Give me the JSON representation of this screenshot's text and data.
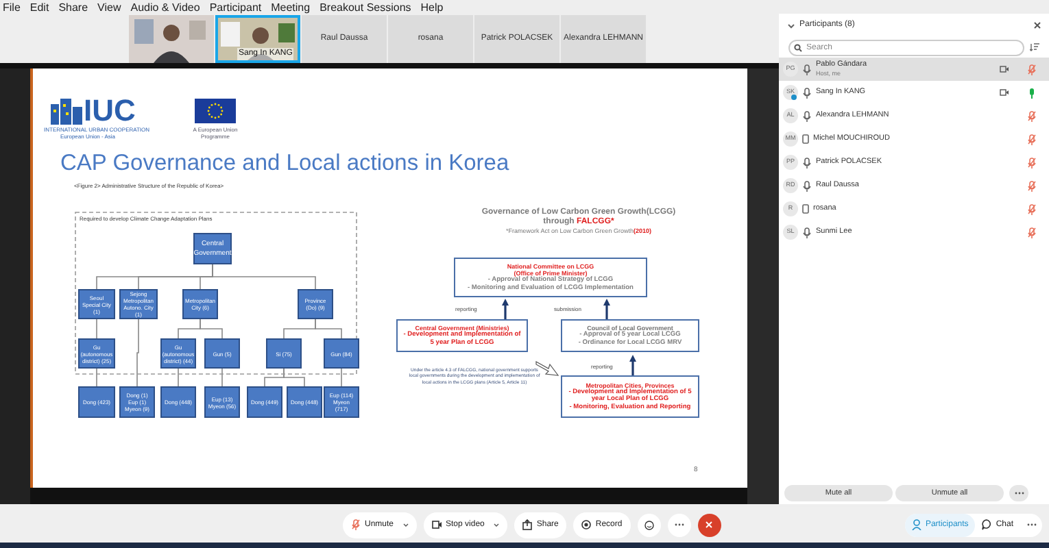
{
  "menu_bar": [
    "File",
    "Edit",
    "Share",
    "View",
    "Audio & Video",
    "Participant",
    "Meeting",
    "Breakout Sessions",
    "Help"
  ],
  "video_strip": [
    {
      "kind": "video",
      "speaking": false
    },
    {
      "kind": "video",
      "name": "Sang In KANG",
      "speaking": true
    },
    {
      "kind": "tile",
      "name": "Raul Daussa",
      "speaking": false
    },
    {
      "kind": "tile",
      "name": "rosana",
      "speaking": false
    },
    {
      "kind": "tile",
      "name": "Patrick POLACSEK",
      "speaking": false
    },
    {
      "kind": "tile",
      "name": "Alexandra LEHMANN",
      "speaking": false
    }
  ],
  "slide": {
    "logo_sub": "INTERNATIONAL URBAN COOPERATION",
    "logo_sub2": "European Union - Asia",
    "logo": "IUC",
    "eu_caption": "A European Union Programme",
    "title": "CAP Governance and Local actions in Korea",
    "caption": "<Figure 2> Administrative Structure of the Republic of Korea>",
    "frame_label": "Required to develop Climate Change Adaptation Plans",
    "org_chart": {
      "label": "Central Government",
      "children": [
        {
          "label": "Seoul Special City (1)",
          "children": [
            {
              "label": "Gu (autonomous district) (25)",
              "children": [
                {
                  "label": "Dong (423)"
                }
              ]
            }
          ]
        },
        {
          "label": "Sejong Metropolitan Autono. City (1)",
          "children": [
            {
              "label": "Dong (1) Eup (1) Myeon (9)"
            }
          ]
        },
        {
          "label": "Metropolitan City (6)",
          "children": [
            {
              "label": "Gu (autonomous district) (44)",
              "children": [
                {
                  "label": "Dong (448)"
                }
              ]
            },
            {
              "label": "Gun (5)",
              "children": [
                {
                  "label": "Eup (13) Myeon (56)"
                }
              ]
            }
          ]
        },
        {
          "label": "Province (Do) (9)",
          "children": [
            {
              "label": "Si (75)",
              "children": [
                {
                  "label": "Dong (449)"
                },
                {
                  "label": "Dong (448)"
                }
              ]
            },
            {
              "label": "Gun (84)",
              "children": [
                {
                  "label": "Eup (114) Myeon (717)"
                }
              ]
            }
          ]
        }
      ]
    },
    "diagram_title": "Governance of Low Carbon Green Growth(LCGG)",
    "diagram_subtitle": "through",
    "diagram_subtitle_highlight": "FALCGG*",
    "diagram_note": "*Framework Act on Low Carbon Green Growth",
    "diagram_note_highlight": "(2010)",
    "boxes": [
      {
        "heading": {
          "lines": [
            "National Committee on LCGG",
            "(Office of Prime Minister)"
          ],
          "color": "#e02020"
        },
        "items": {
          "lines": [
            "- Approval of National Strategy of LCGG",
            "- Monitoring and Evaluation of LCGG Implementation"
          ],
          "color": "#808080"
        }
      },
      {
        "heading": {
          "lines": [
            "Central Government (Ministries)"
          ],
          "color": "#e02020"
        },
        "items": {
          "lines": [
            "- Development and Implementation of 5 year Plan of LCGG"
          ],
          "color": "#e02020"
        }
      },
      {
        "heading": {
          "lines": [
            "Council of Local Government"
          ],
          "color": "#707070"
        },
        "items": {
          "lines": [
            "- Approval of 5 year Local LCGG",
            "- Ordinance for Local LCGG MRV"
          ],
          "color": "#808080"
        }
      },
      {
        "heading": {
          "lines": [
            "Metropolitan Cities, Provinces"
          ],
          "color": "#e02020"
        },
        "items": {
          "lines": [
            "- Development and Implementation of 5 year Local Plan of LCGG",
            "- Monitoring, Evaluation and Reporting"
          ],
          "color": "#e02020"
        }
      }
    ],
    "arrow_labels": [
      "reporting",
      "submission",
      "reporting"
    ],
    "paragraph": "Under the article 4.3 of FALCGG, national government supports local governments during the development and implementation of local actions in the LCGG plans (Article 5, Article 11)",
    "page_number": "8"
  },
  "participants_panel": {
    "title": "Participants (8)",
    "search_placeholder": "Search",
    "participants": [
      {
        "initials": "PG",
        "name": "Pablo Gándara",
        "subtitle": "Host, me",
        "kind": "mic",
        "video": true,
        "muted": true,
        "selected": true,
        "sharing": false
      },
      {
        "initials": "SK",
        "name": "Sang In KANG",
        "kind": "mic",
        "video": true,
        "muted": false,
        "selected": false,
        "sharing": true
      },
      {
        "initials": "AL",
        "name": "Alexandra LEHMANN",
        "kind": "mic",
        "video": false,
        "muted": true,
        "selected": false,
        "sharing": false
      },
      {
        "initials": "MM",
        "name": "Michel MOUCHIROUD",
        "kind": "phone",
        "video": false,
        "muted": true,
        "selected": false,
        "sharing": false
      },
      {
        "initials": "PP",
        "name": "Patrick POLACSEK",
        "kind": "mic",
        "video": false,
        "muted": true,
        "selected": false,
        "sharing": false
      },
      {
        "initials": "RD",
        "name": "Raul Daussa",
        "kind": "mic",
        "video": false,
        "muted": true,
        "selected": false,
        "sharing": false
      },
      {
        "initials": "R",
        "name": "rosana",
        "kind": "phone",
        "video": false,
        "muted": true,
        "selected": false,
        "sharing": false
      },
      {
        "initials": "SL",
        "name": "Sunmi Lee",
        "kind": "mic",
        "video": false,
        "muted": true,
        "selected": false,
        "sharing": false
      }
    ],
    "buttons": [
      "Mute all",
      "Unmute all"
    ]
  },
  "toolbar": {
    "buttons": [
      {
        "kind": "unmute",
        "label": "Unmute",
        "caret": true
      },
      {
        "kind": "video",
        "label": "Stop video",
        "caret": true
      },
      {
        "kind": "share",
        "label": "Share",
        "caret": false
      },
      {
        "kind": "record",
        "label": "Record",
        "caret": false
      }
    ],
    "side": [
      {
        "kind": "participants",
        "label": "Participants",
        "selected": true
      },
      {
        "kind": "chat",
        "label": "Chat",
        "selected": false
      }
    ]
  }
}
